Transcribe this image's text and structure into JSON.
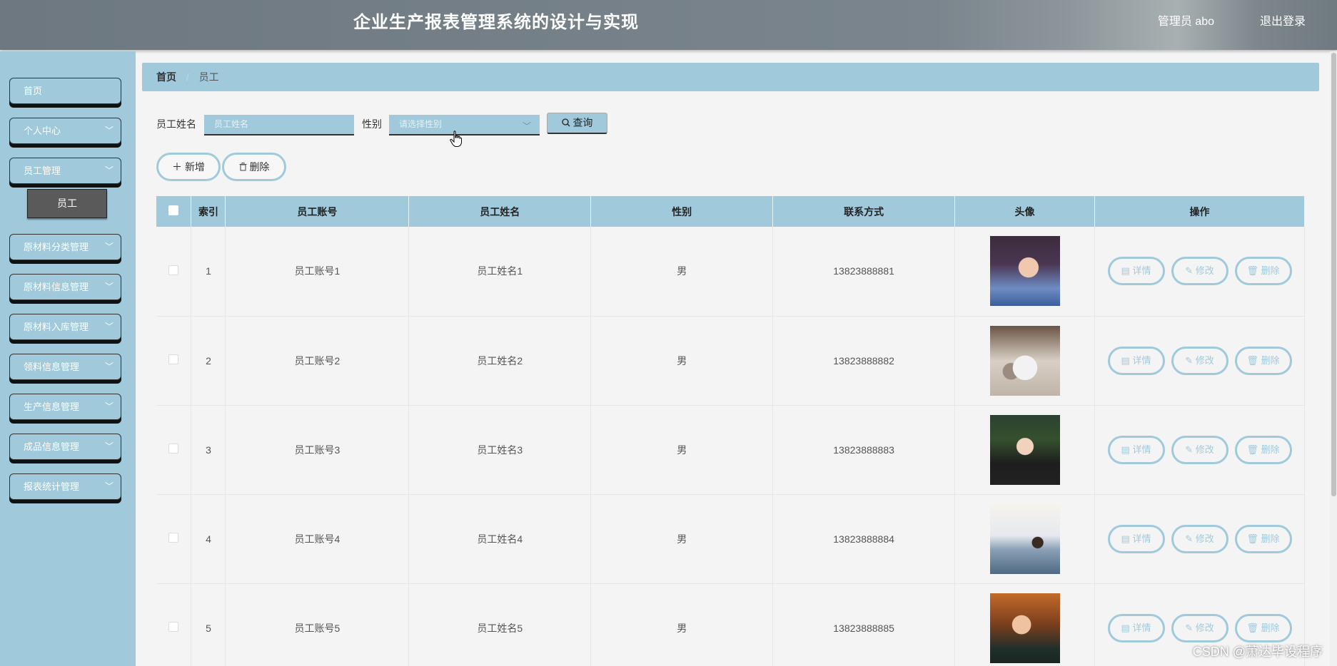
{
  "header": {
    "title": "企业生产报表管理系统的设计与实现",
    "user": "管理员 abo",
    "logout": "退出登录"
  },
  "sidebar": {
    "items": [
      {
        "label": "首页"
      },
      {
        "label": "个人中心"
      },
      {
        "label": "员工管理"
      },
      {
        "label": "原材料分类管理"
      },
      {
        "label": "原材料信息管理"
      },
      {
        "label": "原材料入库管理"
      },
      {
        "label": "领料信息管理"
      },
      {
        "label": "生产信息管理"
      },
      {
        "label": "成品信息管理"
      },
      {
        "label": "报表统计管理"
      }
    ],
    "active_sub": "员工"
  },
  "breadcrumb": {
    "home": "首页",
    "separator": "/",
    "current": "员工"
  },
  "search": {
    "name_label": "员工姓名",
    "name_placeholder": "员工姓名",
    "gender_label": "性别",
    "gender_placeholder": "请选择性别",
    "query_label": "查询"
  },
  "actions": {
    "add": "新增",
    "delete": "删除"
  },
  "table": {
    "headers": [
      "索引",
      "员工账号",
      "员工姓名",
      "性别",
      "联系方式",
      "头像",
      "操作"
    ],
    "rows": [
      {
        "index": "1",
        "account": "员工账号1",
        "name": "员工姓名1",
        "gender": "男",
        "phone": "13823888881"
      },
      {
        "index": "2",
        "account": "员工账号2",
        "name": "员工姓名2",
        "gender": "男",
        "phone": "13823888882"
      },
      {
        "index": "3",
        "account": "员工账号3",
        "name": "员工姓名3",
        "gender": "男",
        "phone": "13823888883"
      },
      {
        "index": "4",
        "account": "员工账号4",
        "name": "员工姓名4",
        "gender": "男",
        "phone": "13823888884"
      },
      {
        "index": "5",
        "account": "员工账号5",
        "name": "员工姓名5",
        "gender": "男",
        "phone": "13823888885"
      }
    ],
    "row_actions": {
      "detail": "详情",
      "edit": "修改",
      "delete": "删除"
    }
  },
  "watermark": "CSDN @萧达毕设程序",
  "colors": {
    "accent": "#a0cadb",
    "header": "#7a858d",
    "submenu": "#5a5a5a"
  }
}
